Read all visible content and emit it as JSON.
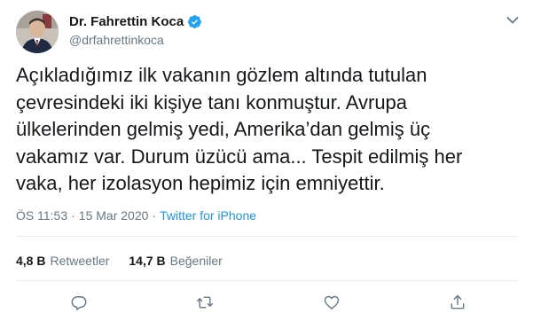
{
  "author": {
    "name": "Dr. Fahrettin Koca",
    "handle": "@drfahrettinkoca",
    "verified": true
  },
  "tweet": {
    "text": "Açıkladığımız ilk vakanın gözlem altında tutulan\nçevresindeki iki kişiye tanı konmuştur. Avrupa\nülkelerinden gelmiş yedi, Amerika’dan gelmiş üç\nvakamız var. Durum üzücü ama... Tespit edilmiş her\nvaka, her izolasyon hepimiz için emniyettir."
  },
  "meta": {
    "time": "ÖS 11:53",
    "separator": "·",
    "date": "15 Mar 2020",
    "source": "Twitter for iPhone"
  },
  "stats": {
    "retweets_count": "4,8 B",
    "retweets_label": "Retweetler",
    "likes_count": "14,7 B",
    "likes_label": "Beğeniler"
  },
  "colors": {
    "text": "#14171a",
    "secondary": "#657786",
    "link": "#1b95e0",
    "verified": "#1da1f2",
    "divider": "#e6ecf0"
  },
  "icons": [
    "verified-badge-icon",
    "chevron-down-icon",
    "reply-icon",
    "retweet-icon",
    "like-icon",
    "share-icon"
  ]
}
